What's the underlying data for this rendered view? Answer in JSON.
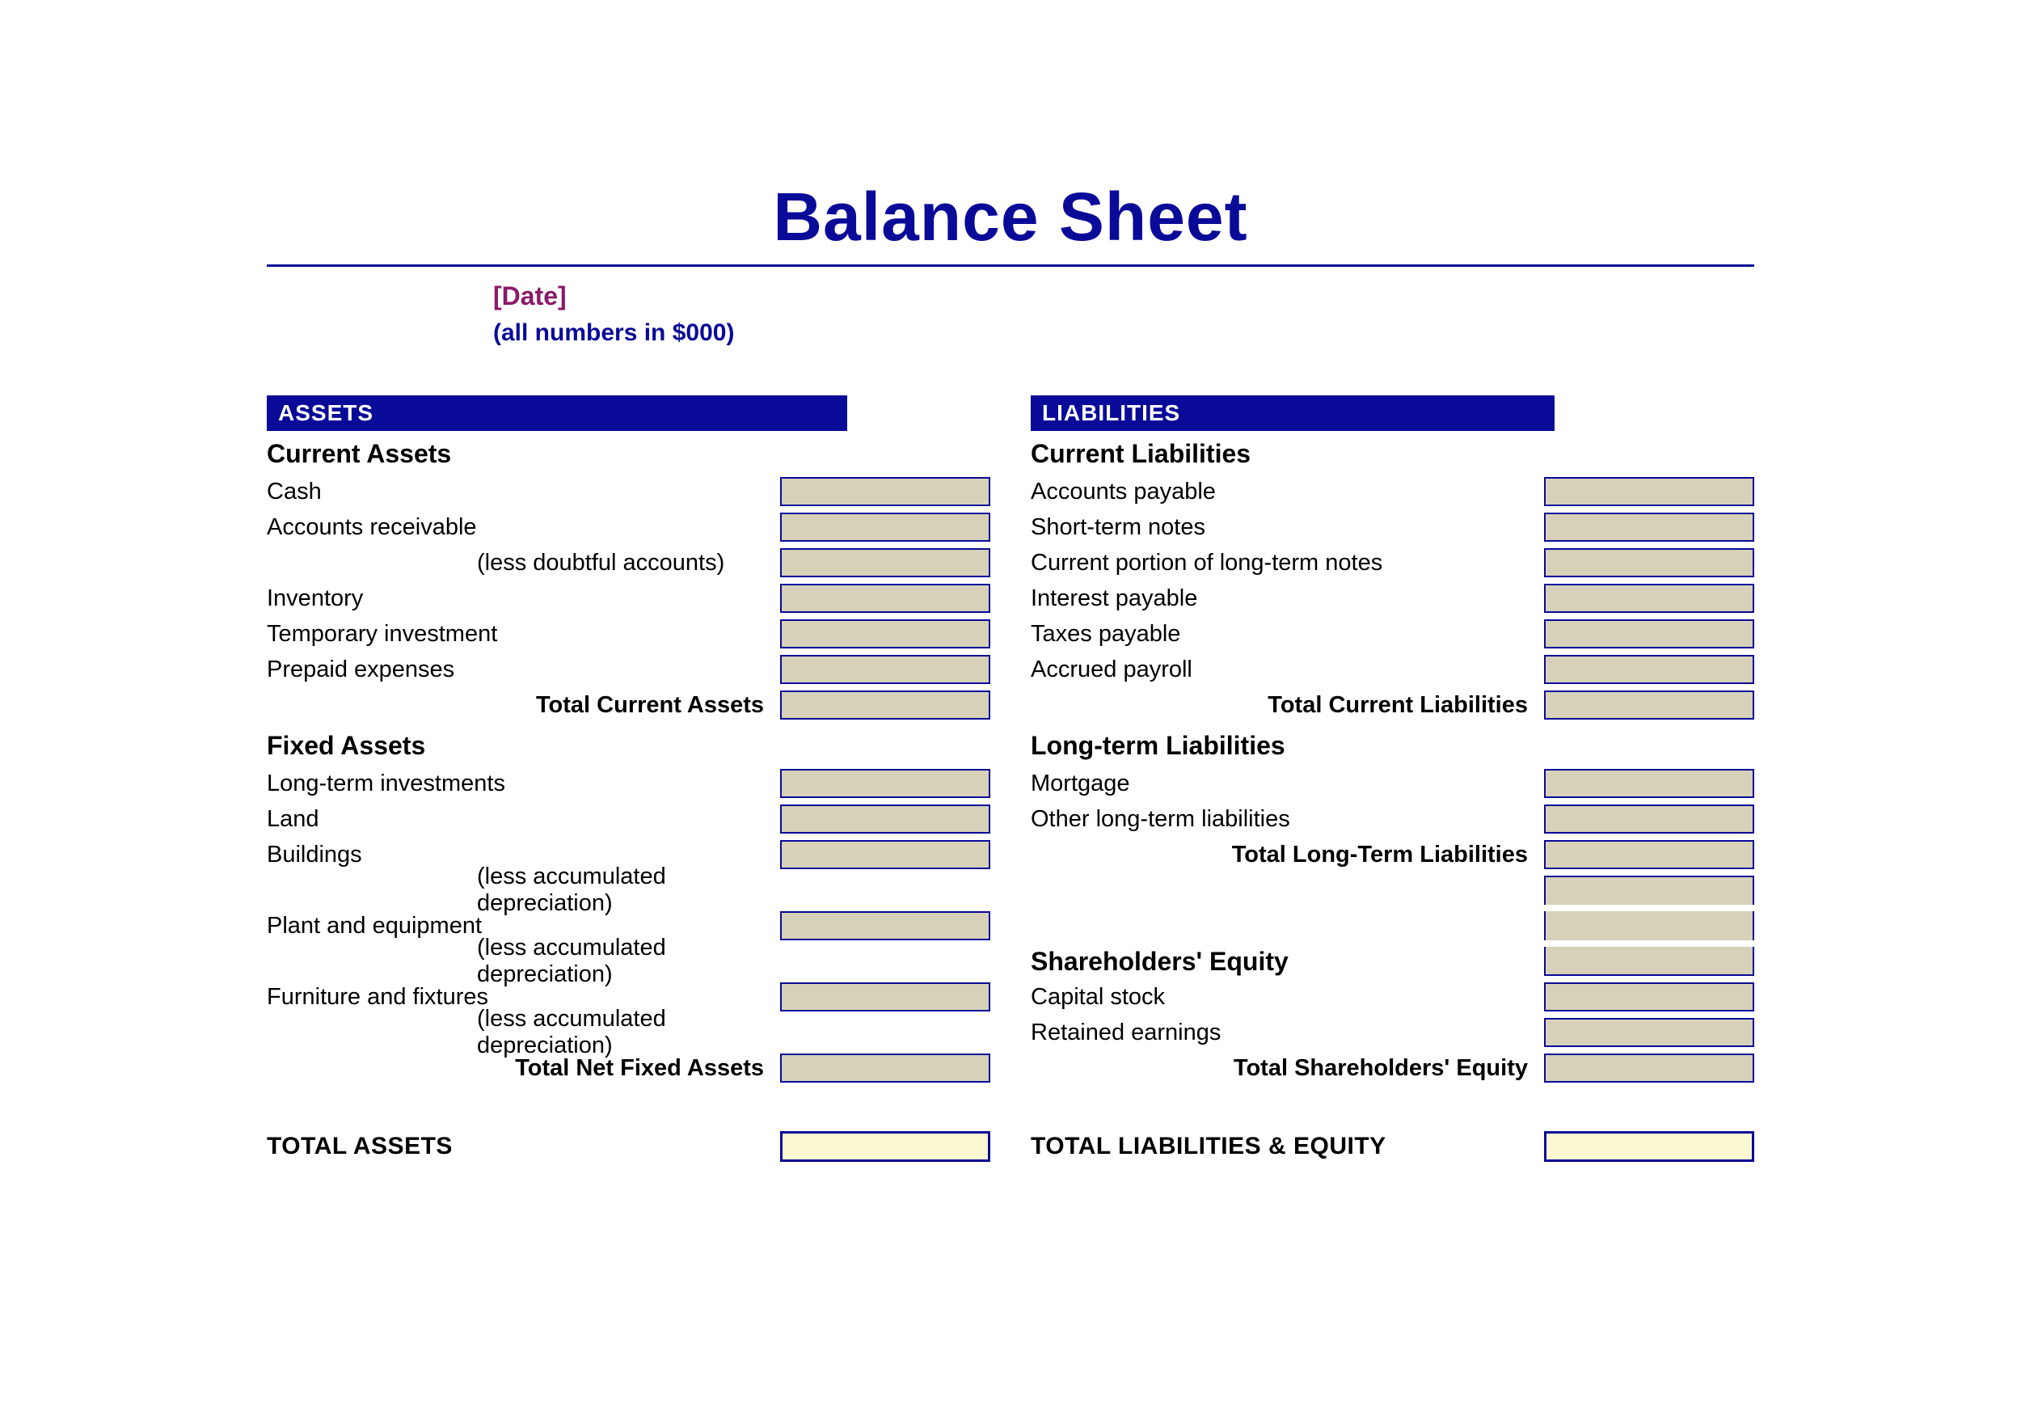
{
  "title": "Balance Sheet",
  "date_placeholder": "[Date]",
  "units_note": "(all numbers in $000)",
  "left": {
    "header": "ASSETS",
    "section1": {
      "title": "Current Assets",
      "rows": [
        "Cash",
        "Accounts receivable",
        "(less doubtful accounts)",
        "Inventory",
        "Temporary investment",
        "Prepaid expenses"
      ],
      "total": "Total Current Assets"
    },
    "section2": {
      "title": "Fixed Assets",
      "rows": [
        "Long-term investments",
        "Land",
        "Buildings",
        "(less accumulated depreciation)",
        "Plant and equipment",
        "(less accumulated depreciation)",
        "Furniture and fixtures",
        "(less accumulated depreciation)"
      ],
      "total": "Total Net Fixed Assets"
    },
    "grand_total": "TOTAL ASSETS"
  },
  "right": {
    "header": "LIABILITIES",
    "section1": {
      "title": "Current Liabilities",
      "rows": [
        "Accounts payable",
        "Short-term notes",
        "Current portion of long-term notes",
        "Interest payable",
        "Taxes payable",
        "Accrued payroll"
      ],
      "total": "Total Current Liabilities"
    },
    "section2": {
      "title": "Long-term Liabilities",
      "rows": [
        "Mortgage",
        "Other long-term liabilities"
      ],
      "total": "Total Long-Term Liabilities"
    },
    "section3": {
      "title": "Shareholders' Equity",
      "rows": [
        "Capital stock",
        "Retained earnings"
      ],
      "total": "Total Shareholders' Equity"
    },
    "grand_total": "TOTAL LIABILITIES & EQUITY"
  }
}
